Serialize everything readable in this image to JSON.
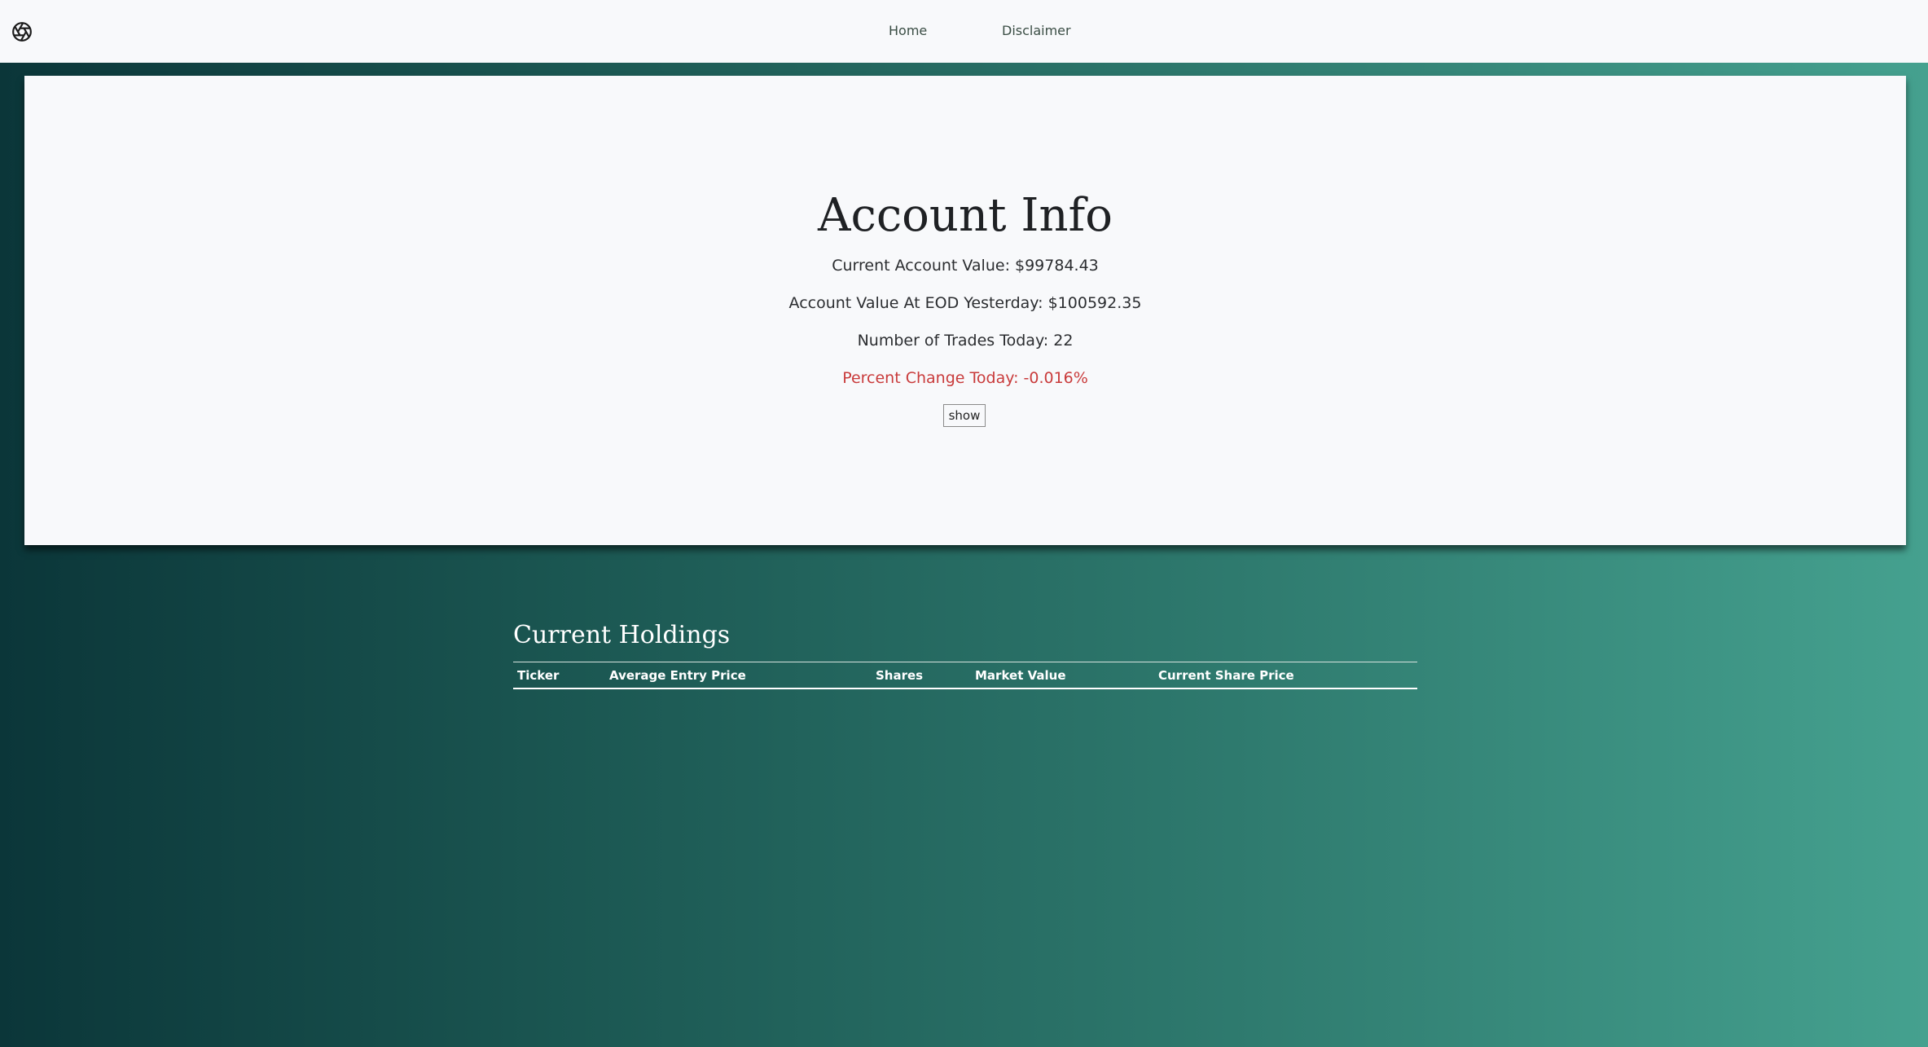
{
  "nav": {
    "logo_icon": "aperture-icon",
    "links": [
      "Home",
      "Disclaimer"
    ]
  },
  "account": {
    "title": "Account Info",
    "current_value": "Current Account Value: $99784.43",
    "eod_value": "Account Value At EOD Yesterday: $100592.35",
    "trades_today": "Number of Trades Today: 22",
    "percent_change": "Percent Change Today: -0.016%",
    "percent_change_color": "#c93b3b",
    "show_label": "show"
  },
  "holdings": {
    "title": "Current Holdings",
    "columns": [
      "Ticker",
      "Average Entry Price",
      "Shares",
      "Market Value",
      "Current Share Price"
    ],
    "rows": []
  },
  "colors": {
    "navbar_bg": "#f8f9fb",
    "gradient_start": "#0b3639",
    "gradient_end": "#45a18f"
  }
}
